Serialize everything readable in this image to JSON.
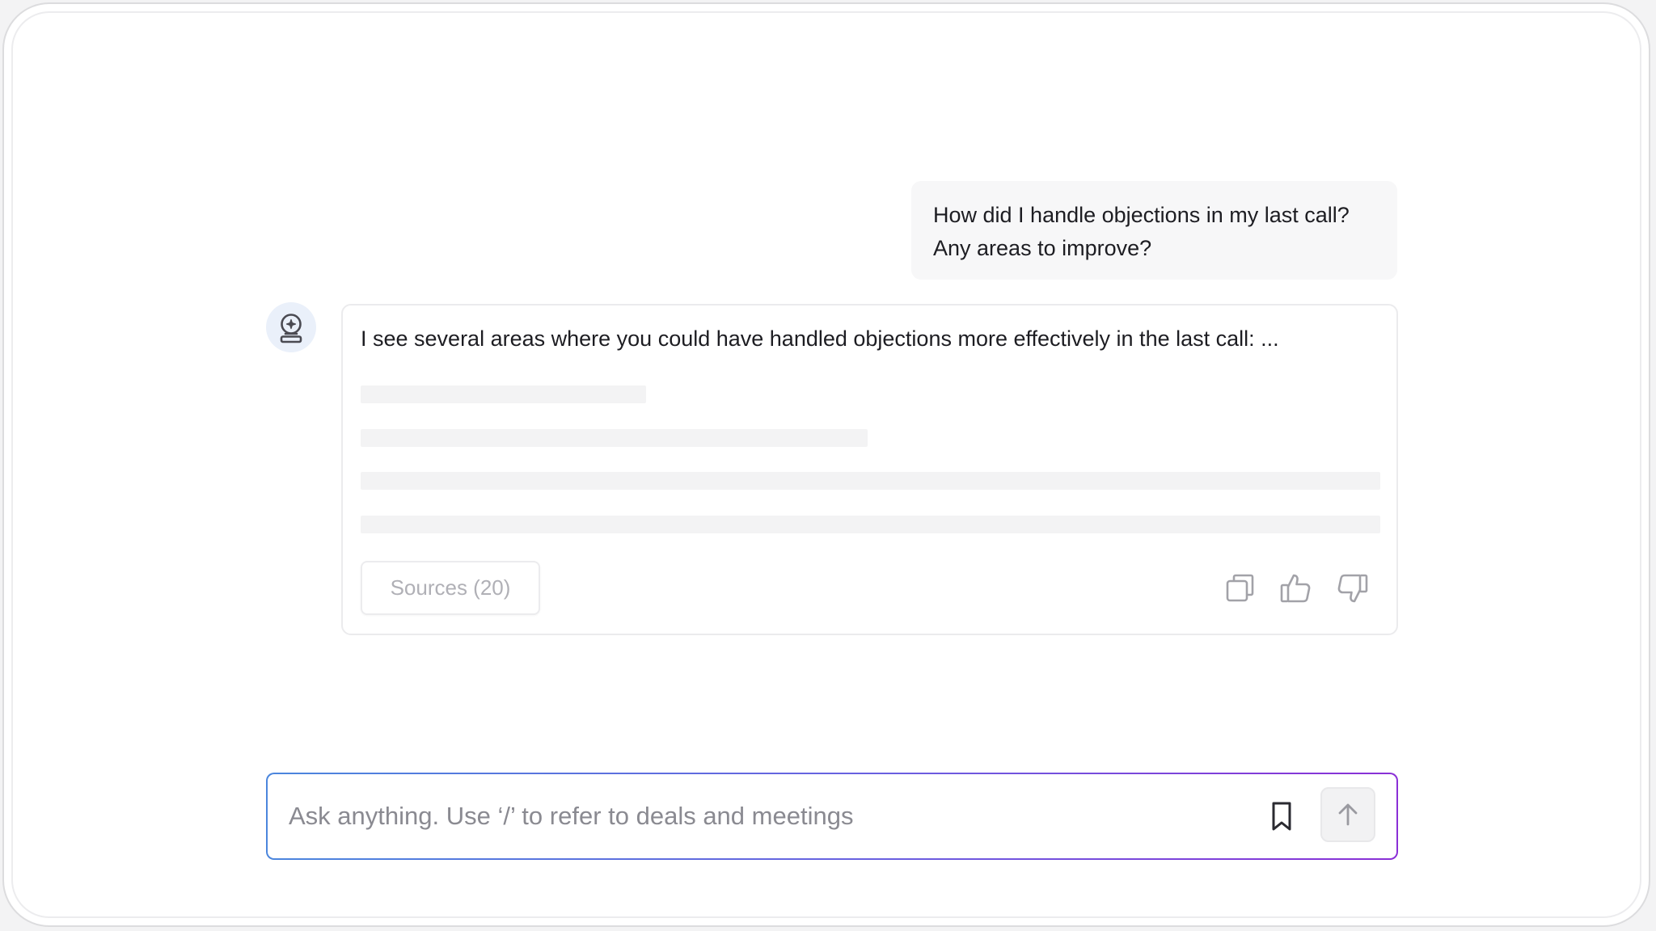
{
  "conversation": {
    "user_message": {
      "line1": "How did I handle objections in my last call?",
      "line2": "Any areas to improve?"
    },
    "assistant_message": {
      "avatar_icon": "assistant-bot-icon",
      "text": "I see several areas where you could have handled objections more effectively in the last call: ...",
      "loading": true,
      "sources_label": "Sources (20)",
      "actions": {
        "copy_icon": "copy-icon",
        "thumbs_up_icon": "thumbs-up-icon",
        "thumbs_down_icon": "thumbs-down-icon"
      }
    }
  },
  "composer": {
    "placeholder": "Ask anything. Use ‘/’ to refer to deals and meetings",
    "value": "",
    "bookmark_icon": "bookmark-icon",
    "send_icon": "arrow-up-icon",
    "border_gradient": [
      "#4b86dd",
      "#8a2fd6"
    ]
  },
  "colors": {
    "text": "#1d1d22",
    "muted": "#8a8a91",
    "bubble_bg": "#f7f7f8",
    "skeleton": "#f3f3f4",
    "avatar_bg": "#eaf0fa"
  }
}
